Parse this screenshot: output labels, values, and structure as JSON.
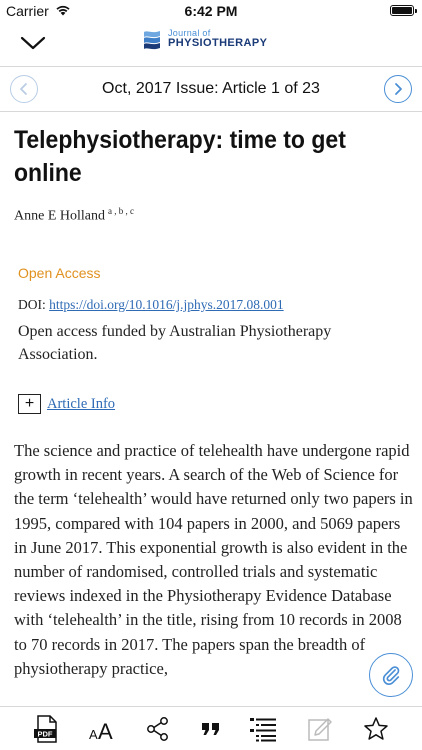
{
  "status_bar": {
    "carrier": "Carrier",
    "time": "6:42 PM"
  },
  "header": {
    "logo_small": "Journal of",
    "logo_big": "PHYSIOTHERAPY"
  },
  "issue_nav": {
    "title": "Oct, 2017 Issue: Article 1 of 23"
  },
  "article": {
    "title": "Telephysiotherapy: time to get online",
    "author": "Anne E Holland",
    "author_affiliations": "a , b , c",
    "open_access": "Open Access",
    "doi_label": "DOI: ",
    "doi_link": "https://doi.org/10.1016/j.jphys.2017.08.001",
    "funding": "Open access funded by Australian Physiotherapy Association.",
    "article_info": "Article Info",
    "body": "The science and practice of telehealth have undergone rapid growth in recent years. A search of the Web of Science for the term ‘telehealth’ would have returned only two papers in 1995, compared with 104 papers in 2000, and 5069 papers in June 2017. This exponential growth is also evident in the number of randomised, controlled trials and systematic reviews indexed in the Physiotherapy Evidence Database with ‘telehealth’ in the title, rising from 10 records in 2008 to 70 records in 2017. The papers span the breadth of physiotherapy practice,"
  },
  "toolbar": {
    "icons": [
      "pdf-icon",
      "text-size-icon",
      "share-icon",
      "quote-icon",
      "outline-icon",
      "notes-icon",
      "bookmark-star-icon"
    ]
  },
  "colors": {
    "accent": "#4a8fd6",
    "link": "#2f6bb5",
    "open_access": "#e0911f",
    "brand_dark": "#1a3a78"
  }
}
